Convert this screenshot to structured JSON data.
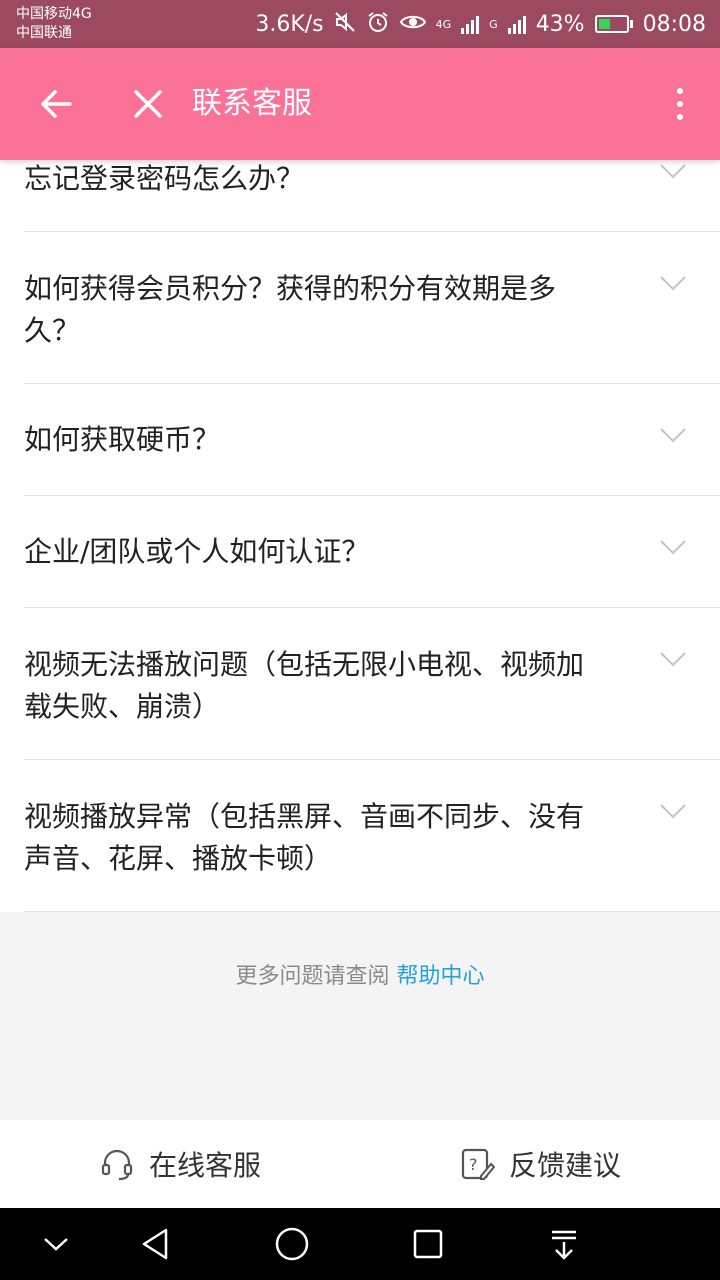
{
  "status_bar": {
    "carrier1": "中国移动4G",
    "carrier2": "中国联通",
    "speed": "3.6K/s",
    "net1": "4G",
    "net2": "G",
    "battery": "43%",
    "time": "08:08",
    "icons": [
      "mute-icon",
      "alarm-icon",
      "eye-icon",
      "signal-icon",
      "battery-icon"
    ]
  },
  "app_bar": {
    "title": "联系客服",
    "back_icon": "arrow-left-icon",
    "close_icon": "close-icon",
    "more_icon": "more-vertical-icon",
    "color": "#fb7299"
  },
  "faq": {
    "items": [
      {
        "question": "忘记登录密码怎么办？"
      },
      {
        "question": "如何获得会员积分？获得的积分有效期是多久？"
      },
      {
        "question": "如何获取硬币？"
      },
      {
        "question": "企业/团队或个人如何认证？"
      },
      {
        "question": "视频无法播放问题（包括无限小电视、视频加载失败、崩溃）"
      },
      {
        "question": "视频播放异常（包括黑屏、音画不同步、没有声音、花屏、播放卡顿）"
      }
    ]
  },
  "footer": {
    "help_text": "更多问题请查阅",
    "help_link": "帮助中心",
    "link_color": "#23a2d9"
  },
  "bottom_bar": {
    "online_service": "在线客服",
    "feedback": "反馈建议"
  },
  "nav_bar": {
    "icons": [
      "chevron-down-icon",
      "back-triangle-icon",
      "home-circle-icon",
      "recents-square-icon",
      "notification-pull-icon"
    ]
  }
}
